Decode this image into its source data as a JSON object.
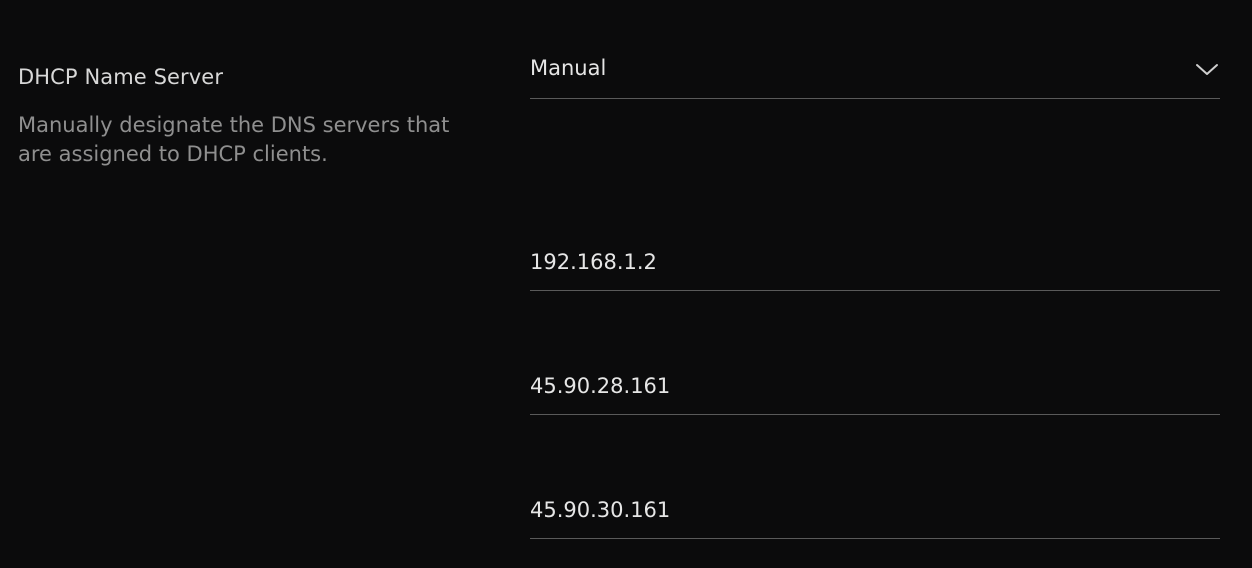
{
  "setting": {
    "label": "DHCP Name Server",
    "description": "Manually designate the DNS servers that are assigned to DHCP clients."
  },
  "mode_select": {
    "selected": "Manual",
    "icon": "chevron-down-icon"
  },
  "dns_servers": [
    {
      "value": "192.168.1.2"
    },
    {
      "value": "45.90.28.161"
    },
    {
      "value": "45.90.30.161"
    }
  ],
  "colors": {
    "background": "#0b0b0c",
    "label": "#d8d8d8",
    "description": "#8f8f8f",
    "value": "#e6e6e6",
    "underline": "#5a5a5a"
  }
}
